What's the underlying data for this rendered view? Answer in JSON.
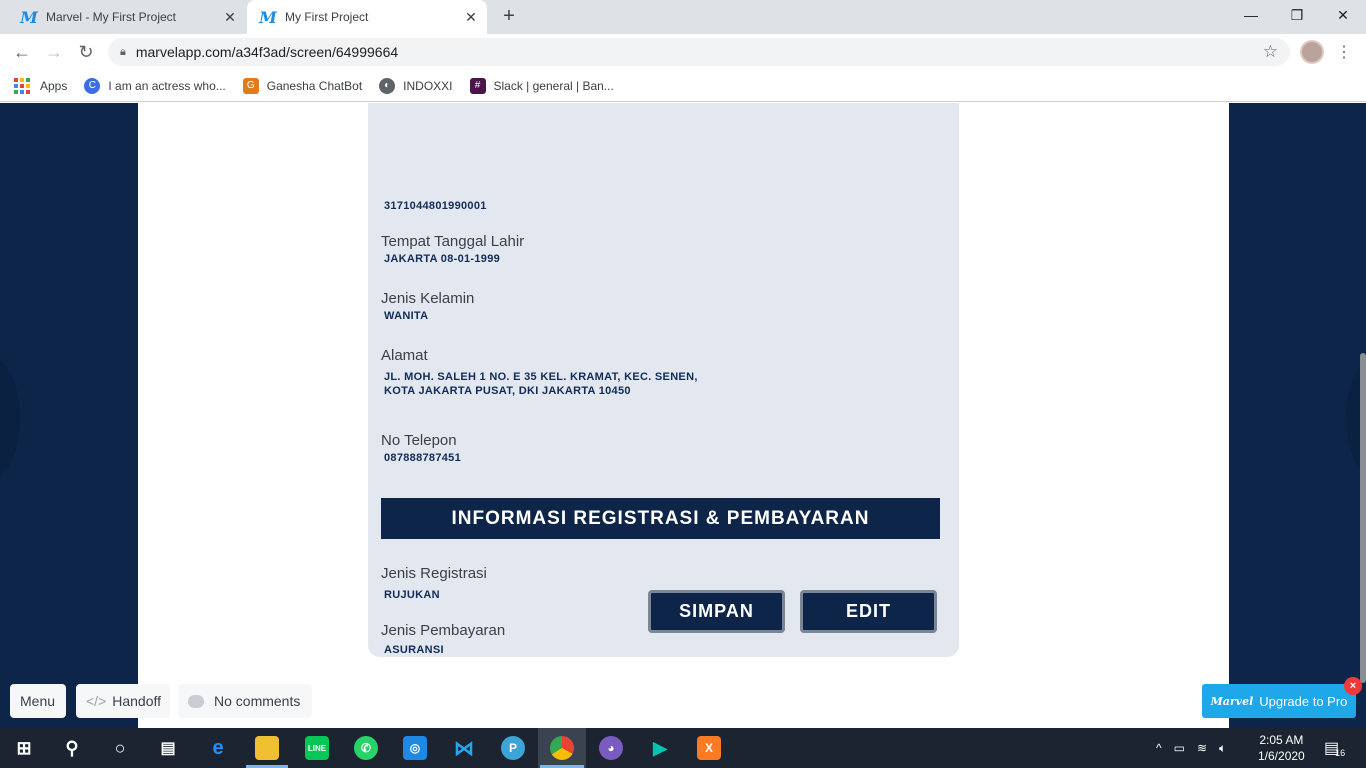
{
  "browser": {
    "tabs": [
      {
        "title": "Marvel - My First Project",
        "active": false
      },
      {
        "title": "My First Project",
        "active": true
      }
    ],
    "url": "marvelapp.com/a34f3ad/screen/64999664",
    "bookmarks": [
      {
        "label": "Apps",
        "icon": "apps-grid-icon"
      },
      {
        "label": "I am an actress who...",
        "icon": "c-circle-icon"
      },
      {
        "label": "Ganesha ChatBot",
        "icon": "ganesha-icon"
      },
      {
        "label": "INDOXXI",
        "icon": "globe-icon"
      },
      {
        "label": "Slack | general | Ban...",
        "icon": "slack-icon"
      }
    ]
  },
  "form": {
    "nik_value": "3171044801990001",
    "ttl_label": "Tempat Tanggal Lahir",
    "ttl_value": "JAKARTA 08-01-1999",
    "gender_label": "Jenis Kelamin",
    "gender_value": "WANITA",
    "address_label": "Alamat",
    "address_line1": "JL. MOH. SALEH 1 NO. E 35 KEL. KRAMAT, KEC. SENEN,",
    "address_line2": "KOTA JAKARTA PUSAT, DKI JAKARTA 10450",
    "phone_label": "No Telepon",
    "phone_value": "087888787451",
    "section_title": "INFORMASI REGISTRASI & PEMBAYARAN",
    "reg_label": "Jenis Registrasi",
    "reg_value": "RUJUKAN",
    "payment_label": "Jenis Pembayaran",
    "payment_value": "ASURANSI",
    "save_label": "SIMPAN",
    "edit_label": "EDIT"
  },
  "marvel": {
    "menu_label": "Menu",
    "handoff_label": "Handoff",
    "comments_label": "No comments",
    "upgrade_label": "Upgrade to Pro",
    "upgrade_logo": "Marvel"
  },
  "taskbar": {
    "time": "2:05 AM",
    "date": "1/6/2020",
    "notification_count": "16"
  },
  "colors": {
    "navy": "#0c2548",
    "card": "#e3e7f0",
    "marvel_blue": "#1ea7e9"
  }
}
